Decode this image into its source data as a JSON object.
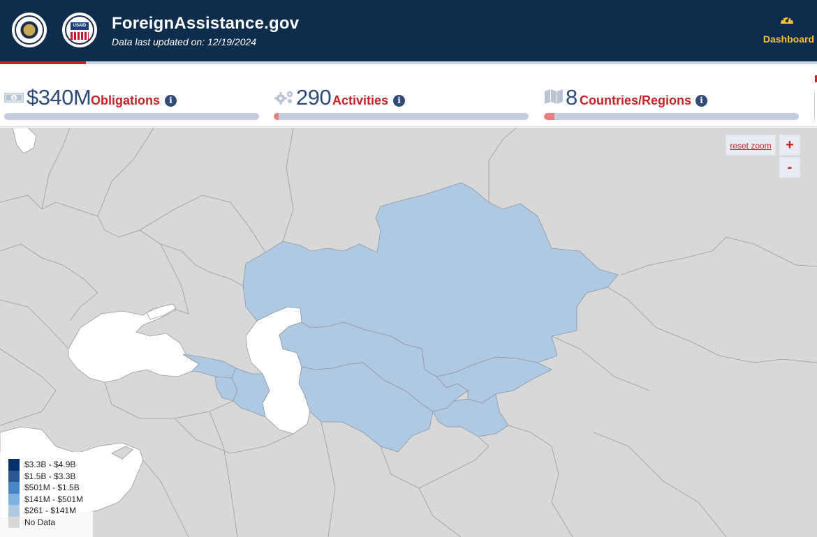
{
  "header": {
    "site_title": "ForeignAssistance.gov",
    "updated_text": "Data last updated on: 12/19/2024",
    "logos": {
      "dos": "us-department-of-state-seal",
      "usaid": "usaid-seal",
      "usaid_text": "USAID"
    },
    "dashboard_label": "Dashboard",
    "dashboard_icon": "speedometer-icon",
    "accent_color": "#f2c230",
    "background_color": "#0e2d4d"
  },
  "stats": [
    {
      "icon": "money-icon",
      "value": "$340M",
      "label": "Obligations",
      "info_icon": "info-icon",
      "bar_fill_fraction": 0
    },
    {
      "icon": "gears-icon",
      "value": "290",
      "label": "Activities",
      "info_icon": "info-icon",
      "bar_fill_fraction": 0.02
    },
    {
      "icon": "map-icon",
      "value": "8",
      "label": "Countries/Regions",
      "info_icon": "info-icon",
      "bar_fill_fraction": 0.04
    }
  ],
  "map": {
    "reset_zoom_label": "reset zoom",
    "zoom_in_label": "+",
    "zoom_out_label": "-",
    "highlighted_fill": "#b0c9e2",
    "no_data_fill": "#d8d8d8",
    "water_fill": "#ffffff",
    "legend": [
      {
        "label": "$3.3B - $4.9B",
        "color": "#08306b"
      },
      {
        "label": "$1.5B - $3.3B",
        "color": "#2b5797"
      },
      {
        "label": "$501M - $1.5B",
        "color": "#4a86c5"
      },
      {
        "label": "$141M - $501M",
        "color": "#7eb2df"
      },
      {
        "label": "$261 - $141M",
        "color": "#b0c9e2"
      },
      {
        "label": "No Data",
        "color": "#d8d8d8"
      }
    ]
  }
}
